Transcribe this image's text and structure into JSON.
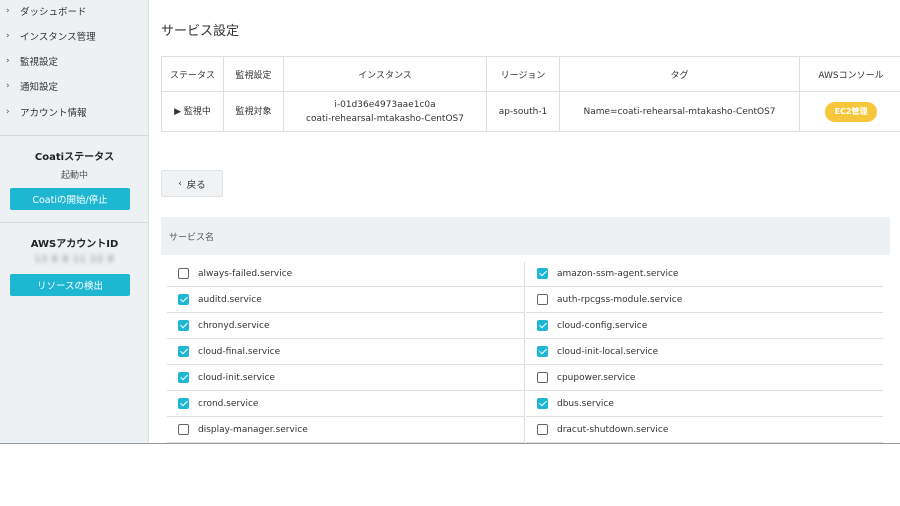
{
  "sidebar": {
    "nav": [
      {
        "label": "ダッシュボード"
      },
      {
        "label": "インスタンス管理"
      },
      {
        "label": "監視設定"
      },
      {
        "label": "通知設定"
      },
      {
        "label": "アカウント情報"
      }
    ],
    "coati_status": {
      "heading": "Coatiステータス",
      "value": "起動中",
      "button": "Coatiの開始/停止"
    },
    "aws_account": {
      "heading": "AWSアカウントID",
      "value": "13 8 8  11 22  8",
      "button": "リソースの検出"
    }
  },
  "main": {
    "title": "サービス設定",
    "table": {
      "headers": [
        "ステータス",
        "監視設定",
        "インスタンス",
        "リージョン",
        "タグ",
        "AWSコンソール"
      ],
      "row": {
        "status": "▶ 監視中",
        "monitoring": "監視対象",
        "instance_id": "i-01d36e4973aae1c0a",
        "instance_name": "coati-rehearsal-mtakasho-CentOS7",
        "region": "ap-south-1",
        "tag": "Name=coati-rehearsal-mtakasho-CentOS7",
        "console_button": "EC2管理"
      }
    },
    "back_button": "戻る",
    "service_header": "サービス名",
    "services_left": [
      {
        "name": "always-failed.service",
        "checked": false
      },
      {
        "name": "auditd.service",
        "checked": true
      },
      {
        "name": "chronyd.service",
        "checked": true
      },
      {
        "name": "cloud-final.service",
        "checked": true
      },
      {
        "name": "cloud-init.service",
        "checked": true
      },
      {
        "name": "crond.service",
        "checked": true
      },
      {
        "name": "display-manager.service",
        "checked": false
      }
    ],
    "services_right": [
      {
        "name": "amazon-ssm-agent.service",
        "checked": true
      },
      {
        "name": "auth-rpcgss-module.service",
        "checked": false
      },
      {
        "name": "cloud-config.service",
        "checked": true
      },
      {
        "name": "cloud-init-local.service",
        "checked": true
      },
      {
        "name": "cpupower.service",
        "checked": false
      },
      {
        "name": "dbus.service",
        "checked": true
      },
      {
        "name": "dracut-shutdown.service",
        "checked": false
      }
    ]
  },
  "colors": {
    "accent": "#1eb7d2",
    "badge": "#f6c73b",
    "sidebar_bg": "#eef1f4"
  }
}
